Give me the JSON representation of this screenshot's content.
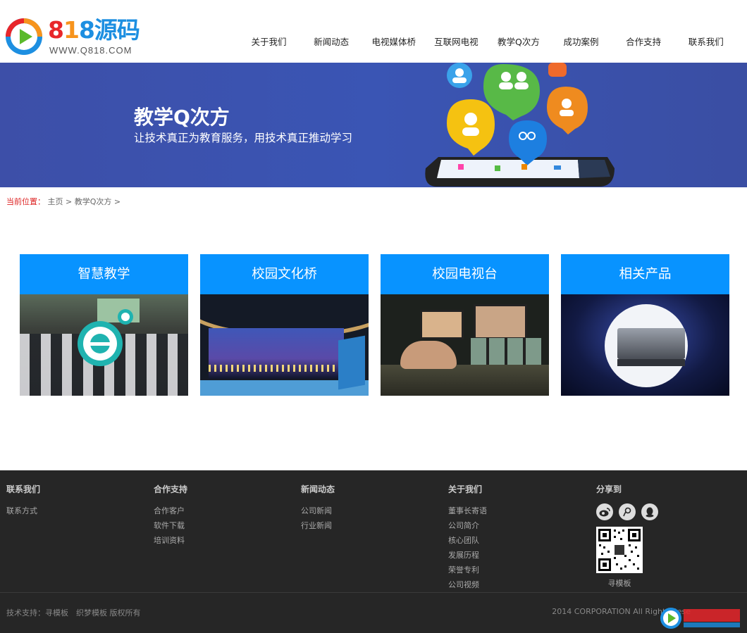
{
  "logo": {
    "digits": [
      "8",
      "1",
      "8"
    ],
    "han": "源码",
    "sub": "WWW.Q818.COM"
  },
  "nav": [
    {
      "label": "关于我们"
    },
    {
      "label": "新闻动态"
    },
    {
      "label": "电视媒体桥"
    },
    {
      "label": "互联网电视"
    },
    {
      "label": "教学Q次方"
    },
    {
      "label": "成功案例"
    },
    {
      "label": "合作支持"
    },
    {
      "label": "联系我们"
    }
  ],
  "banner": {
    "title": "教学Q次方",
    "subtitle": "让技术真正为教育服务，用技术真正推动学习"
  },
  "breadcrumb": {
    "label": "当前位置：",
    "home": "主页",
    "sep": ">",
    "current": "教学Q次方",
    "sep2": ">"
  },
  "cards": [
    {
      "title": "智慧教学"
    },
    {
      "title": "校园文化桥"
    },
    {
      "title": "校园电视台"
    },
    {
      "title": "相关产品"
    }
  ],
  "footer": {
    "cols": [
      {
        "title": "联系我们",
        "links": [
          "联系方式"
        ]
      },
      {
        "title": "合作支持",
        "links": [
          "合作客户",
          "软件下载",
          "培训资料"
        ]
      },
      {
        "title": "新闻动态",
        "links": [
          "公司新闻",
          "行业新闻"
        ]
      },
      {
        "title": "关于我们",
        "links": [
          "董事长寄语",
          "公司简介",
          "核心团队",
          "发展历程",
          "荣誉专利",
          "公司视频"
        ]
      }
    ],
    "share": {
      "title": "分享到",
      "icons": [
        "weibo-icon",
        "tencent-weibo-icon",
        "qq-icon"
      ],
      "qr_caption": "寻模板"
    },
    "copy_left": "技术支持：寻模板　织梦模板 版权所有",
    "copy_right": "2014 CORPORATION All Rights Rese"
  },
  "colors": {
    "accent": "#0893ff",
    "footer_bg": "#262626",
    "banner": "#3d4fa8"
  }
}
